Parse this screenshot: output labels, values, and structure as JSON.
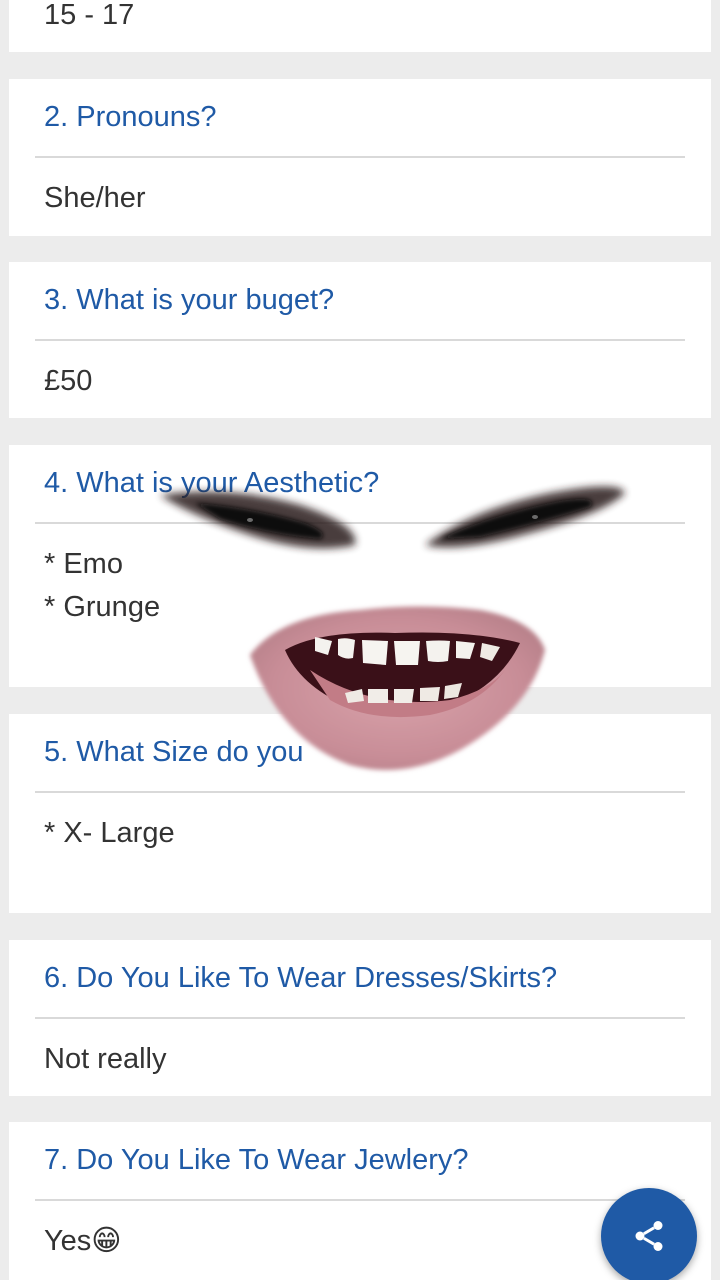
{
  "questions": [
    {
      "title": "",
      "answer": "15 - 17"
    },
    {
      "title": "2. Pronouns?",
      "answer": "She/her"
    },
    {
      "title": "3. What is your buget?",
      "answer": "£50"
    },
    {
      "title": "4. What is your Aesthetic?",
      "answer": "* Emo\n* Grunge"
    },
    {
      "title": "5. What Size do you",
      "answer": "* X- Large"
    },
    {
      "title": "6. Do You Like To Wear Dresses/Skirts?",
      "answer": "Not really"
    },
    {
      "title": "7. Do You Like To Wear Jewlery?",
      "answer": "Yes😁"
    }
  ],
  "fab": {
    "icon": "share-icon",
    "color": "#1f5aa6"
  },
  "overlay": {
    "icon": "face-sticker"
  }
}
